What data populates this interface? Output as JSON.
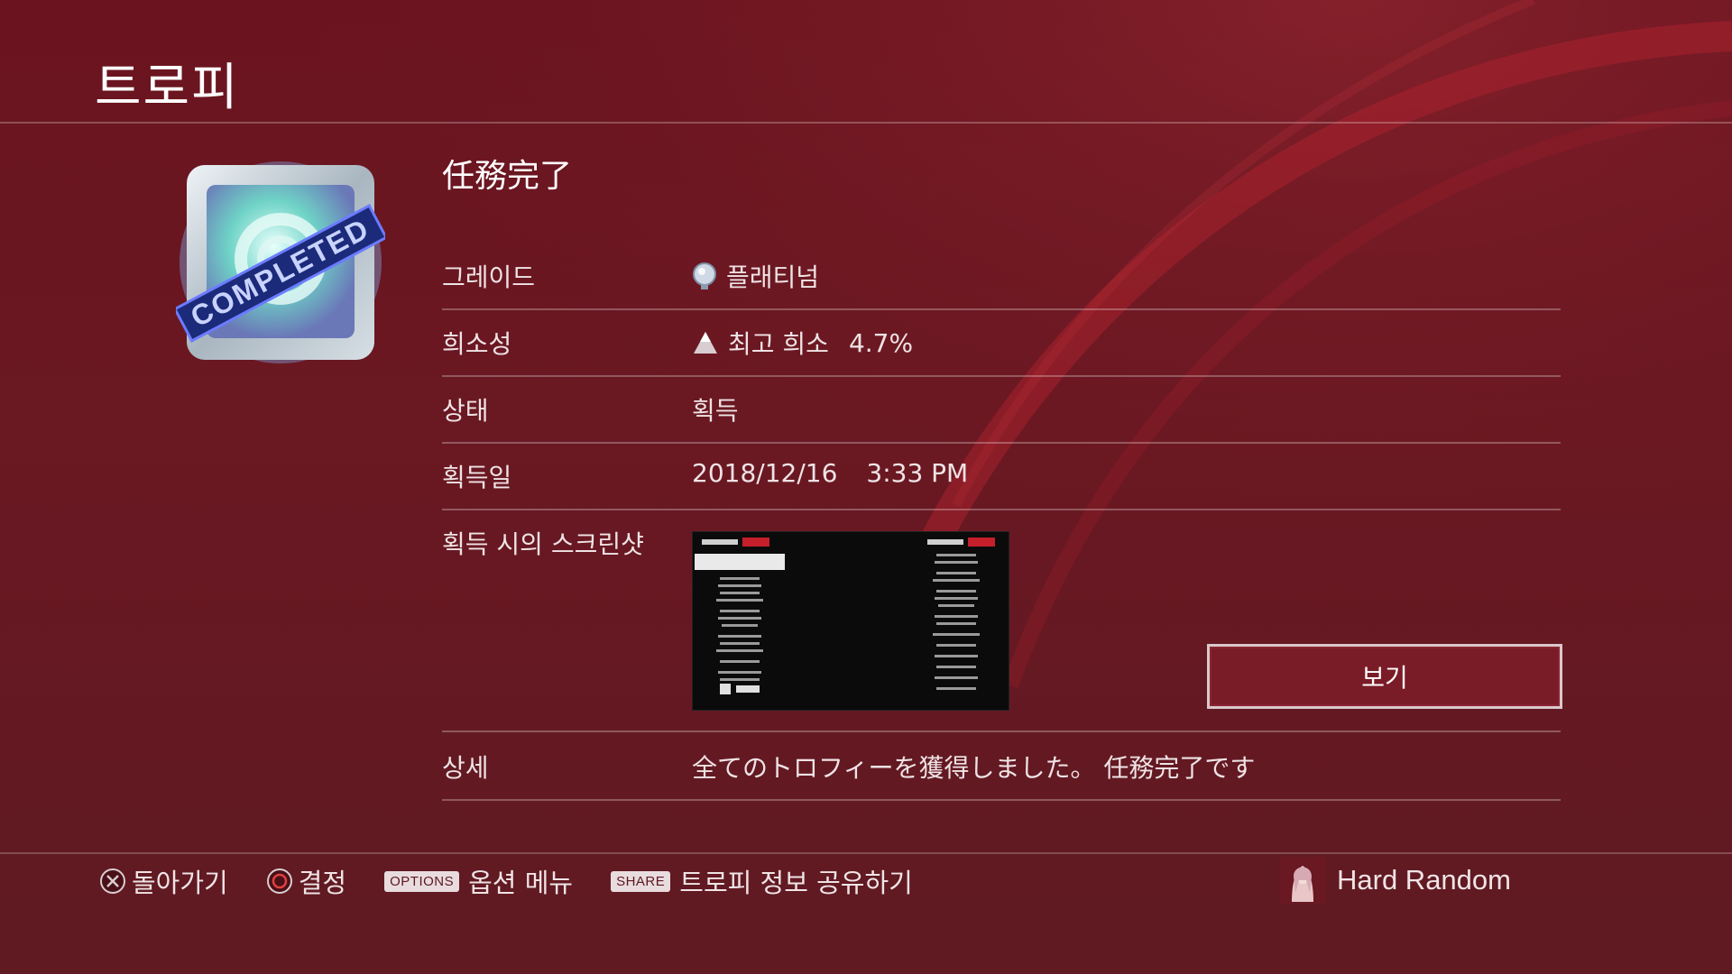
{
  "header": {
    "title": "트로피"
  },
  "trophy": {
    "name": "任務完了",
    "icon_badge_text": "COMPLETED"
  },
  "details": {
    "grade": {
      "label": "그레이드",
      "icon": "platinum-trophy-icon",
      "value": "플래티넘"
    },
    "rarity": {
      "label": "희소성",
      "icon": "rarity-pyramid-icon",
      "value": "최고 희소",
      "percent": "4.7%"
    },
    "status": {
      "label": "상태",
      "value": "획득"
    },
    "earned": {
      "label": "획득일",
      "date": "2018/12/16",
      "time": "3:33 PM"
    },
    "screenshot": {
      "label": "획득 시의 스크린샷"
    },
    "description": {
      "label": "상세",
      "value": "全てのトロフィーを獲得しました。 任務完了です"
    }
  },
  "view_button": {
    "label": "보기"
  },
  "footer": {
    "back": {
      "icon": "cross-button-icon",
      "label": "돌아가기"
    },
    "confirm": {
      "icon": "circle-button-icon",
      "label": "결정"
    },
    "options": {
      "key": "OPTIONS",
      "label": "옵션 메뉴"
    },
    "share": {
      "key": "SHARE",
      "label": "트로피 정보 공유하기"
    }
  },
  "user": {
    "name": "Hard Random"
  },
  "colors": {
    "background": "#6a1822",
    "divider": "#b98a91",
    "button_border": "#d9c8cb",
    "text": "#f2e6e8"
  }
}
